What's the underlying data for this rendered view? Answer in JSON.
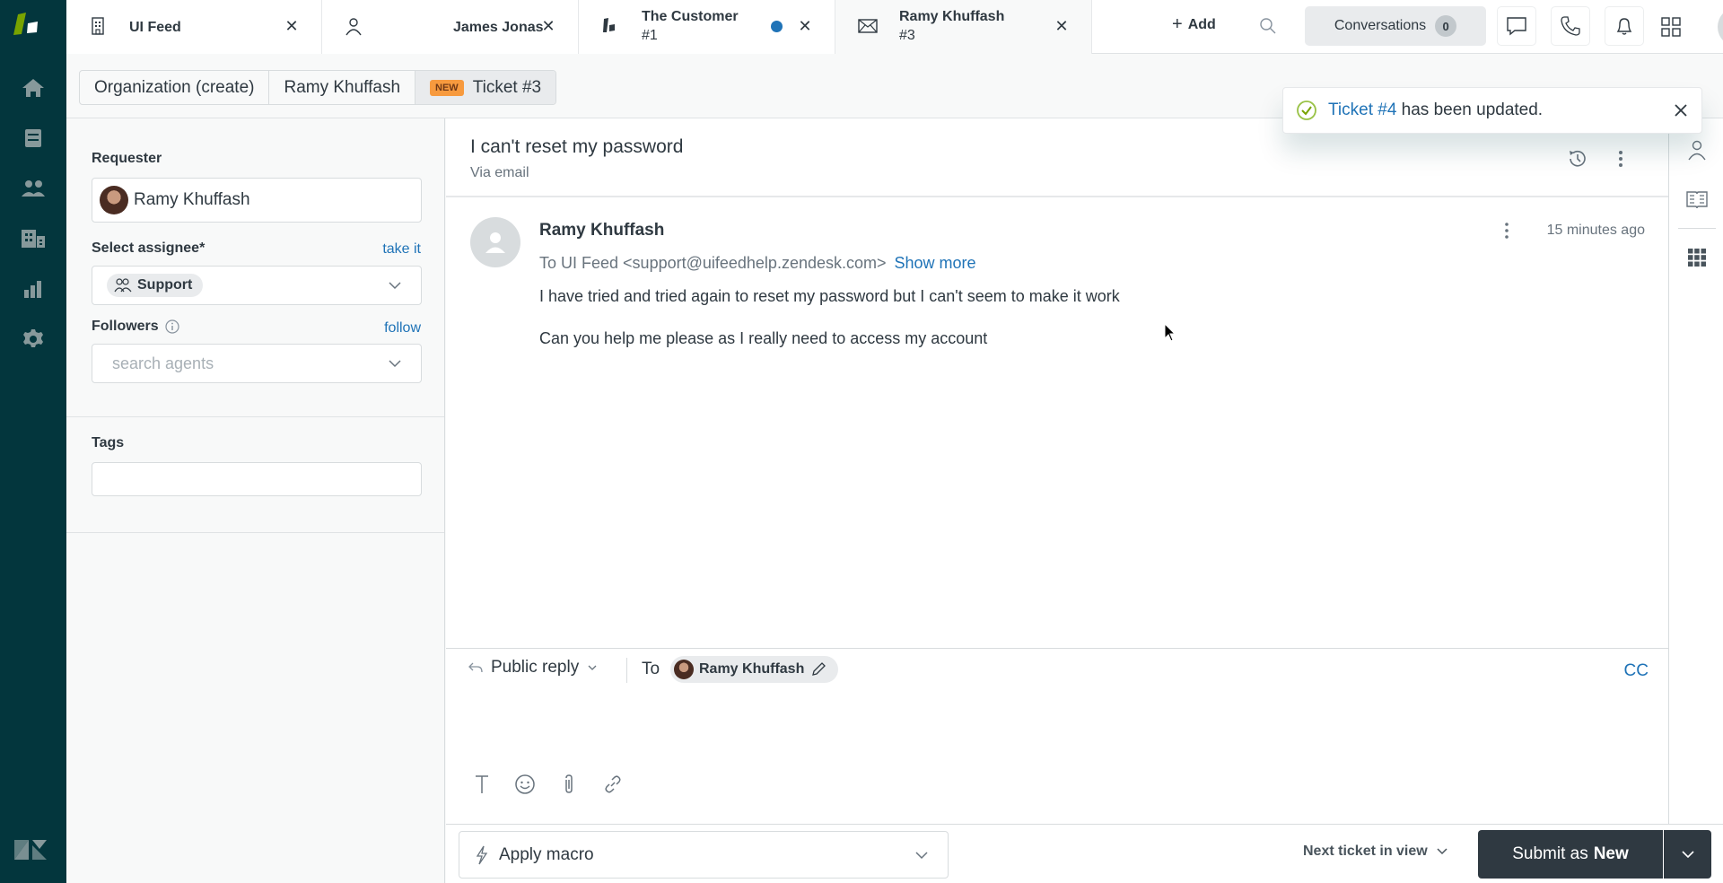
{
  "colors": {
    "nav_bg": "#03363d",
    "brand_green": "#78a300",
    "link_blue": "#1f73b7",
    "new_badge": "#f79a3e",
    "submit_bg": "#2f3941",
    "unread_dot": "#1f73b7",
    "success_green": "#5eae91"
  },
  "nav": {
    "items": [
      {
        "name": "home",
        "icon": "home-icon"
      },
      {
        "name": "views",
        "icon": "views-icon"
      },
      {
        "name": "customers",
        "icon": "users-icon"
      },
      {
        "name": "organizations",
        "icon": "building-icon"
      },
      {
        "name": "reporting",
        "icon": "bar-chart-icon"
      },
      {
        "name": "admin",
        "icon": "gear-icon"
      }
    ]
  },
  "tabs": [
    {
      "label": "UI Feed",
      "icon": "building-icon",
      "closable": true
    },
    {
      "label": "James Jonas",
      "icon": "user-icon",
      "closable": true
    },
    {
      "label_line1": "The Customer",
      "label_line2": "#1",
      "icon": "messaging-icon",
      "unread": true,
      "closable": true
    },
    {
      "label_line1": "Ramy Khuffash",
      "label_line2": "#3",
      "icon": "envelope-icon",
      "closable": true,
      "active": true
    }
  ],
  "topbar": {
    "add_label": "Add",
    "conversations_label": "Conversations",
    "conversations_count": "0"
  },
  "breadcrumb": {
    "items": [
      "Organization (create)",
      "Ramy Khuffash"
    ],
    "current_badge": "NEW",
    "current_label": "Ticket #3"
  },
  "toast": {
    "link": "Ticket #4",
    "text": " has been updated."
  },
  "properties": {
    "requester_label": "Requester",
    "requester_value": "Ramy Khuffash",
    "assignee_label": "Select assignee*",
    "take_it": "take it",
    "assignee_value": "Support",
    "followers_label": "Followers",
    "follow": "follow",
    "followers_placeholder": "search agents",
    "tags_label": "Tags",
    "tags_value": ""
  },
  "ticket": {
    "title": "I can't reset my password",
    "via": "Via email",
    "message": {
      "author": "Ramy Khuffash",
      "time": "15 minutes ago",
      "to": "To UI Feed <support@uifeedhelp.zendesk.com>",
      "show_more": "Show more",
      "body": [
        "I have tried and tried again to reset my password but I can't seem to make it work",
        "Can you help me please as I really need to access my account"
      ]
    }
  },
  "composer": {
    "reply_type": "Public reply",
    "to_label": "To",
    "recipient": "Ramy Khuffash",
    "cc": "CC"
  },
  "footer": {
    "macro_label": "Apply macro",
    "next_ticket": "Next ticket in view",
    "submit_prefix": "Submit as",
    "submit_status": "New"
  }
}
